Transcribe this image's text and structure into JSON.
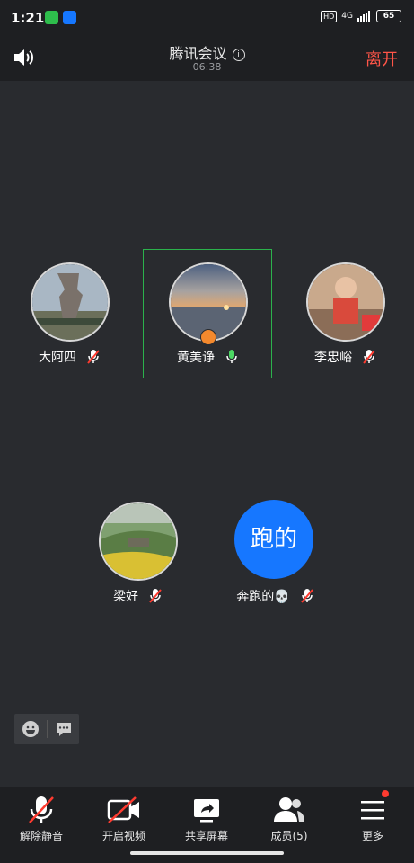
{
  "status": {
    "time": "1:21",
    "network": "4G",
    "hd": "HD",
    "battery": "65"
  },
  "header": {
    "title": "腾讯会议",
    "duration": "06:38",
    "leave_label": "离开"
  },
  "participants": [
    {
      "name": "大阿四",
      "muted": true
    },
    {
      "name": "黄美诤",
      "muted": false,
      "speaking": true
    },
    {
      "name": "李忠峪",
      "muted": true
    },
    {
      "name": "梁好",
      "muted": true
    },
    {
      "name": "奔跑的💀",
      "muted": true,
      "avatar_text": "跑的",
      "avatar_color": "#1677ff"
    }
  ],
  "toolbar": {
    "unmute": "解除静音",
    "start_video": "开启视频",
    "share_screen": "共享屏幕",
    "members": "成员(5)",
    "more": "更多"
  },
  "colors": {
    "leave": "#ff5548",
    "active_border": "#2bb24c",
    "mic_on": "#4cd964",
    "mic_muted": "#ff3b30"
  }
}
